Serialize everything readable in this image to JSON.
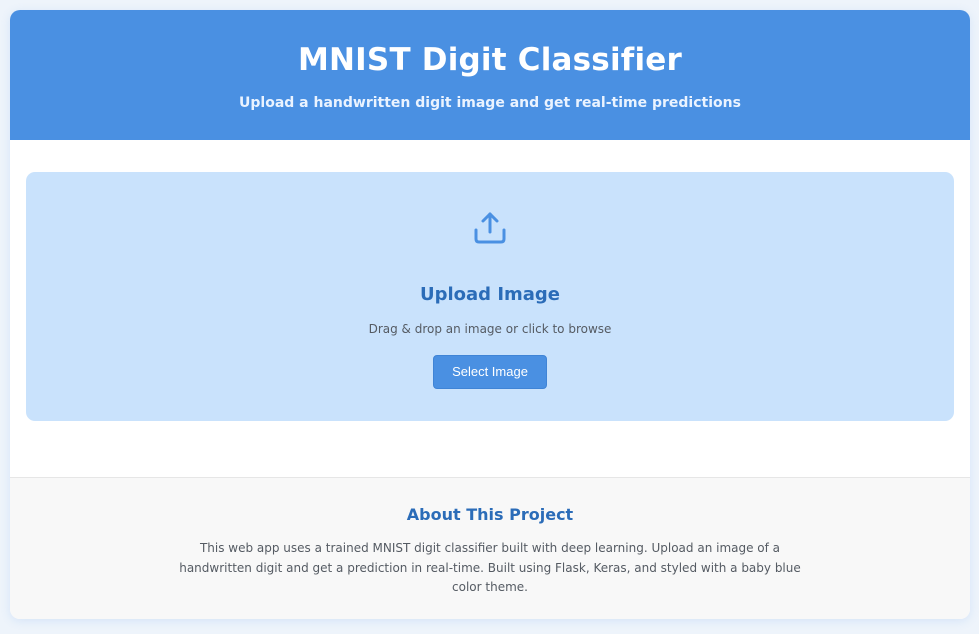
{
  "header": {
    "title": "MNIST Digit Classifier",
    "subtitle": "Upload a handwritten digit image and get real-time predictions"
  },
  "upload": {
    "icon": "upload-icon",
    "title": "Upload Image",
    "hint": "Drag & drop an image or click to browse",
    "button_label": "Select Image"
  },
  "about": {
    "title": "About This Project",
    "description": "This web app uses a trained MNIST digit classifier built with deep learning. Upload an image of a handwritten digit and get a prediction in real-time. Built using Flask, Keras, and styled with a baby blue color theme."
  },
  "colors": {
    "primary": "#4a90e2",
    "dropzone": "#c9e2fc",
    "heading": "#2b6cb8",
    "text": "#555b63"
  }
}
